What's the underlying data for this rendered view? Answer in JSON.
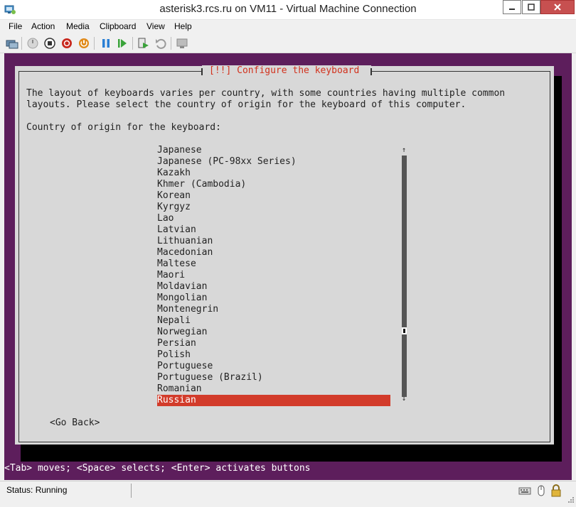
{
  "window": {
    "title": "asterisk3.rcs.ru on VM11 - Virtual Machine Connection"
  },
  "menu": [
    "File",
    "Action",
    "Media",
    "Clipboard",
    "View",
    "Help"
  ],
  "toolbar": {
    "buttons": [
      "ctrl-alt-del-icon",
      "start-icon",
      "turn-off-icon",
      "shut-down-icon",
      "save-icon",
      "pause-icon",
      "reset-icon",
      "checkpoint-icon",
      "revert-icon",
      "enhanced-session-icon"
    ]
  },
  "installer": {
    "dialog_title": "[!!] Configure the keyboard",
    "description": "The layout of keyboards varies per country, with some countries having multiple common\nlayouts. Please select the country of origin for the keyboard of this computer.",
    "prompt": "Country of origin for the keyboard:",
    "items": [
      "Japanese",
      "Japanese (PC-98xx Series)",
      "Kazakh",
      "Khmer (Cambodia)",
      "Korean",
      "Kyrgyz",
      "Lao",
      "Latvian",
      "Lithuanian",
      "Macedonian",
      "Maltese",
      "Maori",
      "Moldavian",
      "Mongolian",
      "Montenegrin",
      "Nepali",
      "Norwegian",
      "Persian",
      "Polish",
      "Portuguese",
      "Portuguese (Brazil)",
      "Romanian",
      "Russian"
    ],
    "selected_item": "Russian",
    "go_back": "<Go Back>",
    "help_line": "<Tab> moves; <Space> selects; <Enter> activates buttons",
    "scroll_up": "↑",
    "scroll_down": "↓"
  },
  "statusbar": {
    "status": "Status: Running"
  },
  "colors": {
    "purple": "#5d1e5c",
    "dialog_bg": "#d8d8d8",
    "selection": "#d23b2a",
    "title_red": "#d2311c"
  }
}
